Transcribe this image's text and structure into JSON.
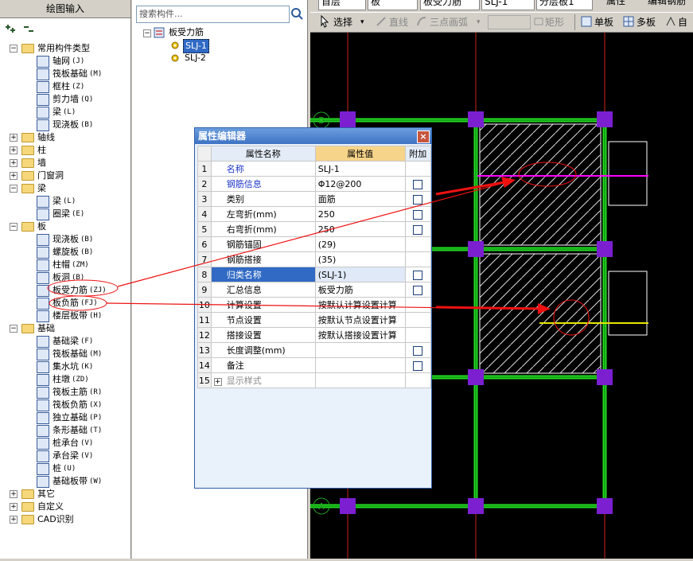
{
  "left_panel": {
    "title": "绘图输入",
    "tree": [
      {
        "label": "常用构件类型",
        "level": 0,
        "type": "folder",
        "expanded": true
      },
      {
        "label": "轴网",
        "code": "(J)",
        "level": 1,
        "type": "leaf",
        "icon": "grid-icon"
      },
      {
        "label": "筏板基础",
        "code": "(M)",
        "level": 1,
        "type": "leaf",
        "icon": "raft-icon"
      },
      {
        "label": "框柱",
        "code": "(Z)",
        "level": 1,
        "type": "leaf",
        "icon": "column-icon"
      },
      {
        "label": "剪力墙",
        "code": "(Q)",
        "level": 1,
        "type": "leaf",
        "icon": "wall-icon"
      },
      {
        "label": "梁",
        "code": "(L)",
        "level": 1,
        "type": "leaf",
        "icon": "beam-icon"
      },
      {
        "label": "现浇板",
        "code": "(B)",
        "level": 1,
        "type": "leaf",
        "icon": "slab-icon"
      },
      {
        "label": "轴线",
        "level": 0,
        "type": "folder",
        "expanded": false
      },
      {
        "label": "柱",
        "level": 0,
        "type": "folder",
        "expanded": false
      },
      {
        "label": "墙",
        "level": 0,
        "type": "folder",
        "expanded": false
      },
      {
        "label": "门窗洞",
        "level": 0,
        "type": "folder",
        "expanded": false
      },
      {
        "label": "梁",
        "level": 0,
        "type": "folder",
        "expanded": true
      },
      {
        "label": "梁",
        "code": "(L)",
        "level": 1,
        "type": "leaf",
        "icon": "beam-icon"
      },
      {
        "label": "圈梁",
        "code": "(E)",
        "level": 1,
        "type": "leaf",
        "icon": "ring-beam-icon"
      },
      {
        "label": "板",
        "level": 0,
        "type": "folder",
        "expanded": true
      },
      {
        "label": "现浇板",
        "code": "(B)",
        "level": 1,
        "type": "leaf",
        "icon": "slab-icon"
      },
      {
        "label": "螺旋板",
        "code": "(B)",
        "level": 1,
        "type": "leaf",
        "icon": "spiral-slab-icon"
      },
      {
        "label": "柱帽",
        "code": "(ZM)",
        "level": 1,
        "type": "leaf",
        "icon": "column-cap-icon"
      },
      {
        "label": "板洞",
        "code": "(B)",
        "level": 1,
        "type": "leaf",
        "icon": "slab-hole-icon"
      },
      {
        "label": "板受力筋",
        "code": "(ZJ)",
        "level": 1,
        "type": "leaf",
        "icon": "slab-rebar-icon"
      },
      {
        "label": "板负筋",
        "code": "(FJ)",
        "level": 1,
        "type": "leaf",
        "icon": "negative-rebar-icon"
      },
      {
        "label": "楼层板带",
        "code": "(H)",
        "level": 1,
        "type": "leaf",
        "icon": "slab-strip-icon"
      },
      {
        "label": "基础",
        "level": 0,
        "type": "folder",
        "expanded": true
      },
      {
        "label": "基础梁",
        "code": "(F)",
        "level": 1,
        "type": "leaf",
        "icon": "foundation-beam-icon"
      },
      {
        "label": "筏板基础",
        "code": "(M)",
        "level": 1,
        "type": "leaf",
        "icon": "raft-icon"
      },
      {
        "label": "集水坑",
        "code": "(K)",
        "level": 1,
        "type": "leaf",
        "icon": "sump-icon"
      },
      {
        "label": "柱墩",
        "code": "(ZD)",
        "level": 1,
        "type": "leaf",
        "icon": "pier-icon"
      },
      {
        "label": "筏板主筋",
        "code": "(R)",
        "level": 1,
        "type": "leaf",
        "icon": "raft-main-rebar-icon"
      },
      {
        "label": "筏板负筋",
        "code": "(X)",
        "level": 1,
        "type": "leaf",
        "icon": "raft-neg-rebar-icon"
      },
      {
        "label": "独立基础",
        "code": "(P)",
        "level": 1,
        "type": "leaf",
        "icon": "isolated-footing-icon"
      },
      {
        "label": "条形基础",
        "code": "(T)",
        "level": 1,
        "type": "leaf",
        "icon": "strip-footing-icon"
      },
      {
        "label": "桩承台",
        "code": "(V)",
        "level": 1,
        "type": "leaf",
        "icon": "pile-cap-icon"
      },
      {
        "label": "承台梁",
        "code": "(V)",
        "level": 1,
        "type": "leaf",
        "icon": "cap-beam-icon"
      },
      {
        "label": "桩",
        "code": "(U)",
        "level": 1,
        "type": "leaf",
        "icon": "pile-icon"
      },
      {
        "label": "基础板带",
        "code": "(W)",
        "level": 1,
        "type": "leaf",
        "icon": "foundation-strip-icon"
      },
      {
        "label": "其它",
        "level": 0,
        "type": "folder",
        "expanded": false
      },
      {
        "label": "自定义",
        "level": 0,
        "type": "folder",
        "expanded": false
      },
      {
        "label": "CAD识别",
        "level": 0,
        "type": "folder",
        "expanded": false
      }
    ]
  },
  "middle_panel": {
    "search_placeholder": "搜索构件...",
    "root_label": "板受力筋",
    "items": [
      "SLJ-1",
      "SLJ-2"
    ]
  },
  "toolbar": {
    "row1": [
      "首层",
      "板",
      "板受力筋",
      "SLJ-1",
      "分层板1",
      "属性",
      "编辑钢筋"
    ],
    "row2": {
      "select": "选择",
      "line": "直线",
      "arc": "三点画弧",
      "rect": "矩形",
      "single": "单板",
      "multi": "多板",
      "auto": "自"
    }
  },
  "dialog": {
    "title": "属性编辑器",
    "close": "×",
    "headers": {
      "name": "属性名称",
      "value": "属性值",
      "add": "附加"
    },
    "rows": [
      {
        "num": "1",
        "name": "名称",
        "value": "SLJ-1",
        "blue": true,
        "checkbox": false
      },
      {
        "num": "2",
        "name": "钢筋信息",
        "value": "Φ12@200",
        "blue": true,
        "checkbox": true
      },
      {
        "num": "3",
        "name": "类别",
        "value": "面筋",
        "blue": false,
        "checkbox": true
      },
      {
        "num": "4",
        "name": "左弯折(mm)",
        "value": "250",
        "blue": false,
        "checkbox": true
      },
      {
        "num": "5",
        "name": "右弯折(mm)",
        "value": "250",
        "blue": false,
        "checkbox": true
      },
      {
        "num": "6",
        "name": "钢筋锚固",
        "value": "(29)",
        "blue": false,
        "checkbox": false
      },
      {
        "num": "7",
        "name": "钢筋搭接",
        "value": "(35)",
        "blue": false,
        "checkbox": false
      },
      {
        "num": "8",
        "name": "归类名称",
        "value": "(SLJ-1)",
        "blue": false,
        "checkbox": true,
        "selected": true
      },
      {
        "num": "9",
        "name": "汇总信息",
        "value": "板受力筋",
        "blue": false,
        "checkbox": true
      },
      {
        "num": "10",
        "name": "计算设置",
        "value": "按默认计算设置计算",
        "blue": false,
        "checkbox": false
      },
      {
        "num": "11",
        "name": "节点设置",
        "value": "按默认节点设置计算",
        "blue": false,
        "checkbox": false
      },
      {
        "num": "12",
        "name": "搭接设置",
        "value": "按默认搭接设置计算",
        "blue": false,
        "checkbox": false
      },
      {
        "num": "13",
        "name": "长度调整(mm)",
        "value": "",
        "blue": false,
        "checkbox": true
      },
      {
        "num": "14",
        "name": "备注",
        "value": "",
        "blue": false,
        "checkbox": true
      },
      {
        "num": "15",
        "name": "显示样式",
        "value": "",
        "blue": false,
        "checkbox": false,
        "gray": true,
        "expander": "+"
      }
    ]
  },
  "canvas": {
    "axis_labels": [
      "B",
      "A"
    ],
    "colors": {
      "background": "#000000",
      "beam": "#22dd22",
      "column": "#7b1fd1",
      "axis": "#cc2222",
      "highlight_magenta": "#ff00ff",
      "highlight_yellow": "#e6e600",
      "annotation": "#ee1111"
    }
  }
}
